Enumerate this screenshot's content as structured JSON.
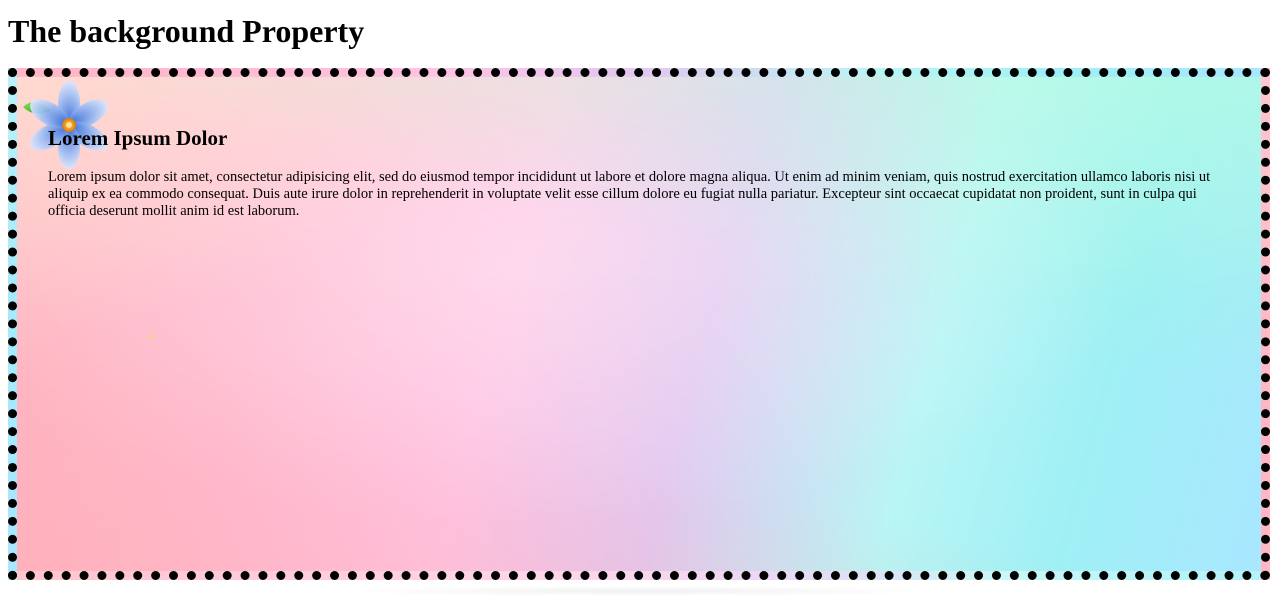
{
  "page": {
    "title": "The background Property"
  },
  "box": {
    "heading": "Lorem Ipsum Dolor",
    "text": "Lorem ipsum dolor sit amet, consectetur adipisicing elit, sed do eiusmod tempor incididunt ut labore et dolore magna aliqua. Ut enim ad minim veniam, quis nostrud exercitation ullamco laboris nisi ut aliquip ex ea commodo consequat. Duis aute irure dolor in reprehenderit in voluptate velit esse cillum dolore eu fugiat nulla pariatur. Excepteur sint occaecat cupidatat non proident, sunt in culpa qui officia deserunt mollit anim id est laborum.",
    "border_style": "dotted",
    "border_color": "#000000",
    "decoration_icon": "blue-flower-icon"
  },
  "colors": {
    "gradient_left": "#ffb3bd",
    "gradient_mid": "#ffc3e3",
    "gradient_right": "#a9e7ff",
    "flower_petal": "#8fb2f0",
    "flower_center": "#f4a21a",
    "leaf": "#3fb52a"
  }
}
